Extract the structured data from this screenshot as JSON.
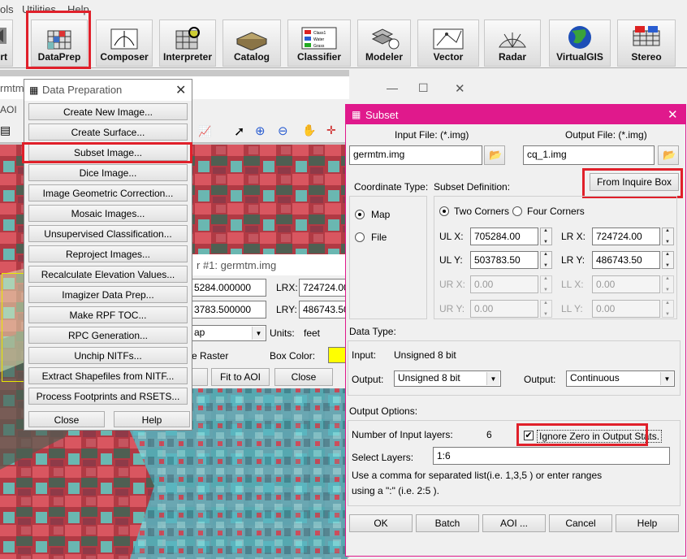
{
  "menubar": {
    "items": [
      "ols",
      "Utilities",
      "Help"
    ]
  },
  "toolbar": {
    "buttons": [
      {
        "label": "ort",
        "icon": "import-icon"
      },
      {
        "label": "DataPrep",
        "icon": "dataprep-icon"
      },
      {
        "label": "Composer",
        "icon": "composer-icon"
      },
      {
        "label": "Interpreter",
        "icon": "interpreter-icon"
      },
      {
        "label": "Catalog",
        "icon": "catalog-icon"
      },
      {
        "label": "Classifier",
        "icon": "classifier-icon"
      },
      {
        "label": "Modeler",
        "icon": "modeler-icon"
      },
      {
        "label": "Vector",
        "icon": "vector-icon"
      },
      {
        "label": "Radar",
        "icon": "radar-icon"
      },
      {
        "label": "VirtualGIS",
        "icon": "globe-icon"
      },
      {
        "label": "Stereo",
        "icon": "stereo-icon"
      }
    ],
    "classifier_legend": [
      "Class1",
      "Water",
      "Grass"
    ]
  },
  "viewer": {
    "title_fragment": "rmtm.im",
    "aoi_label": "AOI"
  },
  "inquire": {
    "title": "r #1: germtm.img",
    "ulx": "5284.000000",
    "uly": "3783.500000",
    "lrx_label": "LRX:",
    "lrx": "724724.00",
    "lry_label": "LRY:",
    "lry": "486743.50",
    "type_value": "ap",
    "units_label": "Units:",
    "units_value": "feet",
    "raster_label": "e Raster",
    "boxcolor_label": "Box Color:",
    "box_color": "#ffff00",
    "fit_aoi": "Fit to AOI",
    "close": "Close"
  },
  "dataprep": {
    "title": "Data Preparation",
    "items": [
      "Create New Image...",
      "Create Surface...",
      "Subset Image...",
      "Dice Image...",
      "Image Geometric Correction...",
      "Mosaic Images...",
      "Unsupervised Classification...",
      "Reproject Images...",
      "Recalculate Elevation Values...",
      "Imagizer Data Prep...",
      "Make RPF TOC...",
      "RPC Generation...",
      "Unchip NITFs...",
      "Extract Shapefiles from NITF...",
      "Process Footprints and RSETS..."
    ],
    "close": "Close",
    "help": "Help"
  },
  "subset": {
    "title": "Subset",
    "input_label": "Input File: (*.img)",
    "input_value": "germtm.img",
    "output_label": "Output File: (*.img)",
    "output_value": "cq_1.img",
    "from_inquire": "From Inquire Box",
    "coord_type_label": "Coordinate Type:",
    "subset_def_label": "Subset Definition:",
    "coord_map": "Map",
    "coord_file": "File",
    "two_corners": "Two Corners",
    "four_corners": "Four Corners",
    "ulx_label": "UL X:",
    "ulx": "705284.00",
    "uly_label": "UL Y:",
    "uly": "503783.50",
    "lrx_label": "LR X:",
    "lrx": "724724.00",
    "lry_label": "LR Y:",
    "lry": "486743.50",
    "urx_label": "UR X:",
    "urx": "0.00",
    "ury_label": "UR Y:",
    "ury": "0.00",
    "llx_label": "LL X:",
    "llx": "0.00",
    "lly_label": "LL Y:",
    "lly": "0.00",
    "data_type_label": "Data Type:",
    "input_type_label": "Input:",
    "input_type_value": "Unsigned 8 bit",
    "output_type_label": "Output:",
    "output_type_value": "Unsigned 8 bit",
    "output2_label": "Output:",
    "output2_value": "Continuous",
    "output_options_label": "Output Options:",
    "num_layers_label": "Number of Input layers:",
    "num_layers": "6",
    "ignore_zero": "Ignore Zero in Output Stats.",
    "select_layers_label": "Select Layers:",
    "select_layers": "1:6",
    "hint1": "Use a comma for separated list(i.e. 1,3,5 ) or enter ranges",
    "hint2": "using a \":\" (i.e. 2:5 ).",
    "ok": "OK",
    "batch": "Batch",
    "aoi": "AOI ...",
    "cancel": "Cancel",
    "help": "Help"
  }
}
